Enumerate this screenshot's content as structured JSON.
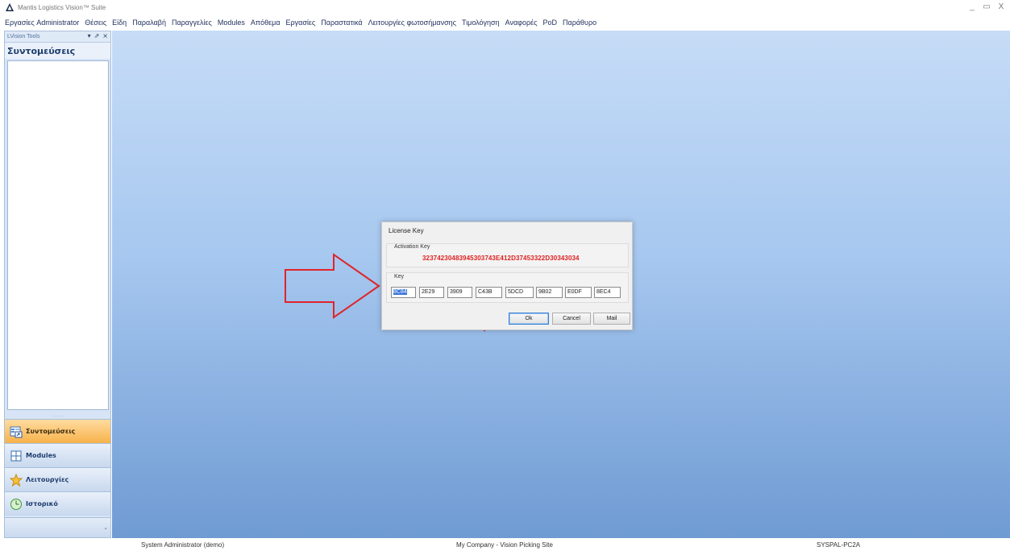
{
  "window": {
    "title": "Mantis Logistics Vision™ Suite",
    "controls": [
      "_",
      "▭",
      "X"
    ]
  },
  "menu": [
    "Εργασίες Administrator",
    "Θέσεις",
    "Είδη",
    "Παραλαβή",
    "Παραγγελίες",
    "Modules",
    "Απόθεμα",
    "Εργασίες",
    "Παραστατικά",
    "Λειτουργίες φωτοσήμανσης",
    "Τιμολόγηση",
    "Αναφορές",
    "PoD",
    "Παράθυρο"
  ],
  "left_panel": {
    "title": "LVision Tools",
    "controls": [
      "▾",
      "⇗",
      "×"
    ],
    "section_title": "Συντομεύσεις",
    "grip": ".....",
    "nav": [
      {
        "label": "Συντομεύσεις",
        "icon": "shortcuts-icon",
        "active": true
      },
      {
        "label": "Modules",
        "icon": "modules-icon",
        "active": false
      },
      {
        "label": "Λειτουργίες",
        "icon": "star-icon",
        "active": false
      },
      {
        "label": "Ιστορικό",
        "icon": "history-icon",
        "active": false
      }
    ],
    "footer_chevron": "⌄"
  },
  "dialog": {
    "title": "License Key",
    "activation_label": "Activation Key",
    "activation_key": "32374230483945303743E412D37453322D30343034",
    "key_label": "Key",
    "key_parts": [
      "8C84",
      "2E29",
      "3909",
      "C43B",
      "5DCD",
      "9B02",
      "E0DF",
      "8EC4"
    ],
    "buttons": {
      "ok": "Ok",
      "cancel": "Cancel",
      "mail": "Mail"
    }
  },
  "status": {
    "user": "System Administrator (demo)",
    "company": "My Company - Vision Picking Site",
    "pc": "SYSPAL-PC2A"
  },
  "colors": {
    "activation_key": "#e02020",
    "arrow_outline": "#e0242a",
    "active_nav": "#f7b24b"
  }
}
